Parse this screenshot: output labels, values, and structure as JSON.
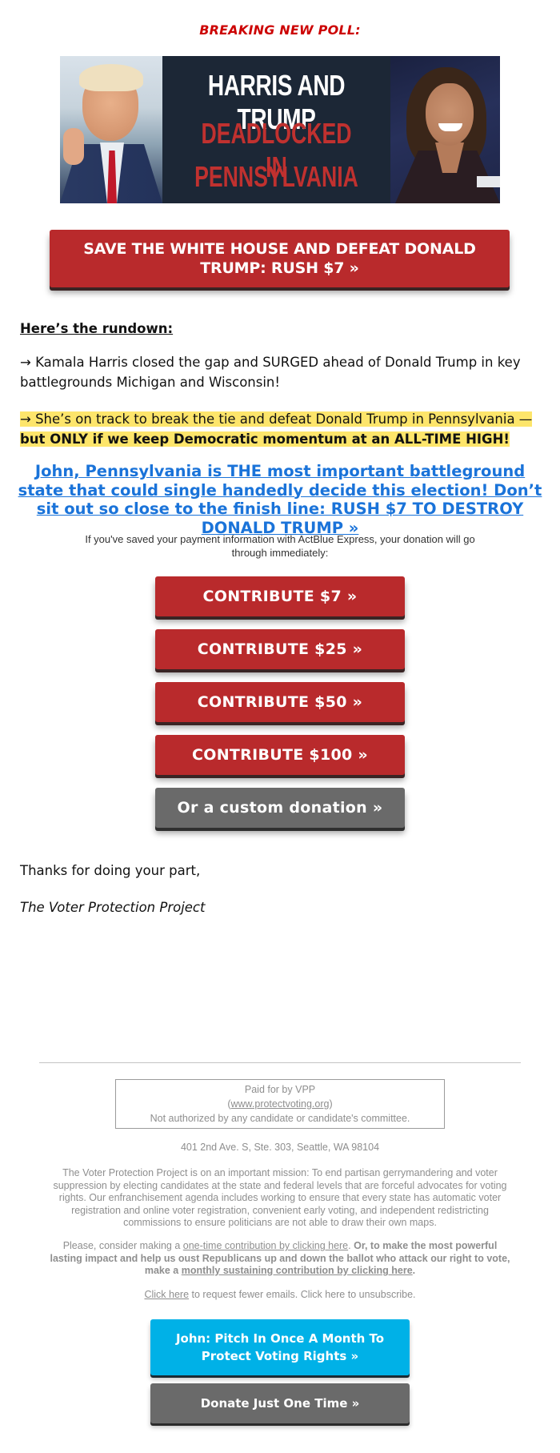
{
  "header": {
    "kicker": "BREAKING NEW POLL:"
  },
  "banner": {
    "line1": "HARRIS AND TRUMP",
    "line2": "DEADLOCKED IN",
    "line3": "PENNSYLVANIA",
    "left_photo": "donald-trump-photo",
    "right_photo": "kamala-harris-photo"
  },
  "cta_top": {
    "label": "SAVE THE WHITE HOUSE AND DEFEAT DONALD TRUMP: RUSH $7 »"
  },
  "body": {
    "rundown_heading": "Here’s the rundown:",
    "para1": "→ Kamala Harris closed the gap and SURGED ahead of Donald Trump in key battlegrounds Michigan and Wisconsin!",
    "para2_highlight": "→ She’s on track to break the tie and defeat Donald Trump in Pennsylvania — ",
    "para2_bold": "but ONLY if we keep Democratic momentum at an ALL-TIME HIGH!",
    "headline_link": "John, Pennsylvania is THE most important battleground state that could single handedly decide this election! Don’t sit out so close to the finish line: RUSH $7 TO DESTROY DONALD TRUMP »",
    "actblue_note": "If you've saved your payment information with ActBlue Express, your donation will go through immediately:"
  },
  "donation_buttons": [
    {
      "label": "CONTRIBUTE $7 »",
      "amount": 7
    },
    {
      "label": "CONTRIBUTE $25 »",
      "amount": 25
    },
    {
      "label": "CONTRIBUTE $50 »",
      "amount": 50
    },
    {
      "label": "CONTRIBUTE $100 »",
      "amount": 100
    },
    {
      "label": "Or a custom donation »"
    }
  ],
  "signoff": {
    "thanks": "Thanks for doing your part,",
    "signature": "The Voter Protection Project"
  },
  "footer": {
    "paid_for": "Paid for by VPP",
    "website_open": "(",
    "website": "www.protectvoting.org",
    "website_close": ")",
    "not_authorized": "Not authorized by any candidate or candidate's committee.",
    "address": "401 2nd Ave. S, Ste. 303, Seattle, WA 98104",
    "mission": "The Voter Protection Project is on an important mission: To end partisan gerrymandering and voter suppression by electing candidates at the state and federal levels that are forceful advocates for voting rights. Our enfranchisement agenda includes working to ensure that every state has automatic voter registration and online voter registration, convenient early voting, and independent redistricting commissions to ensure politicians are not able to draw their own maps.",
    "appeal_prefix": "Please, consider making a ",
    "appeal_link1": "one-time contribution by clicking here",
    "appeal_mid": ". ",
    "appeal_bold": "Or, to make the most powerful lasting impact and help us oust Republicans up and down the ballot who attack our right to vote, make a ",
    "appeal_link2": "monthly sustaining contribution by clicking here",
    "appeal_end": ".",
    "unsub_link": "Click here",
    "unsub_text": " to request fewer emails. Click here to unsubscribe.",
    "monthly_button": "John: Pitch In Once A Month To Protect Voting Rights »",
    "onetime_button": "Donate Just One Time »"
  },
  "colors": {
    "brand_red": "#b92a2c",
    "kicker_red": "#cc0000",
    "link_blue": "#1a73d9",
    "highlight_yellow": "#fde56b",
    "button_gray": "#6a6a6a",
    "monthly_blue": "#00b1e7",
    "footer_gray": "#8e8e8e"
  }
}
